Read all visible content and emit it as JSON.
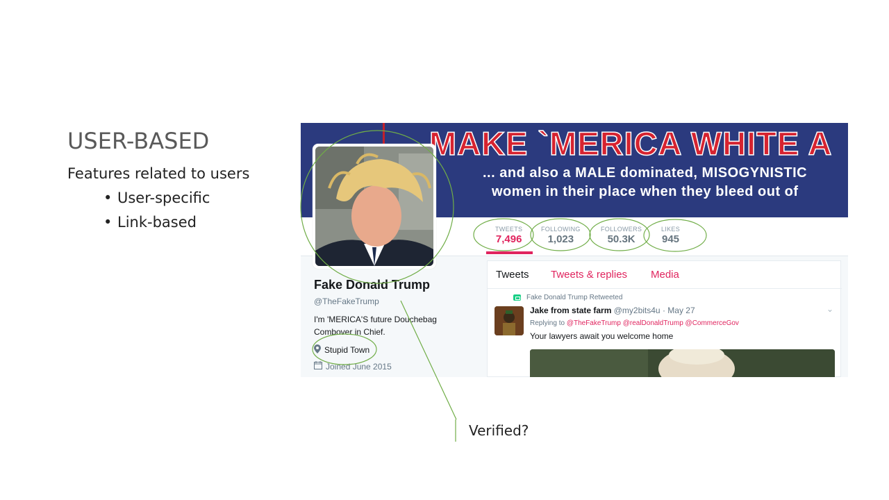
{
  "slide": {
    "title": "USER-BASED",
    "lead": "Features related to users",
    "bullets": [
      "User-specific",
      "Link-based"
    ],
    "callout": "Verified?"
  },
  "banner": {
    "headline": "MAKE `MERICA WHITE A",
    "line1": "... and also a MALE dominated, MISOGYNISTIC",
    "line2": "women in their place when they bleed out of"
  },
  "stats": [
    {
      "label": "TWEETS",
      "value": "7,496"
    },
    {
      "label": "FOLLOWING",
      "value": "1,023"
    },
    {
      "label": "FOLLOWERS",
      "value": "50.3K"
    },
    {
      "label": "LIKES",
      "value": "945"
    }
  ],
  "profile": {
    "name": "Fake Donald Trump",
    "handle": "@TheFakeTrump",
    "bio": "I'm 'MERICA'S future Douchebag Combover in Chief.",
    "location": "Stupid Town",
    "joined": "Joined June 2015"
  },
  "timeline": {
    "tabs": [
      "Tweets",
      "Tweets & replies",
      "Media"
    ],
    "tweet": {
      "retweet_note": "Fake Donald Trump Retweeted",
      "author": "Jake from state farm",
      "author_handle": "@my2bits4u",
      "date": "May 27",
      "replying_label": "Replying to",
      "replying_to": "@TheFakeTrump @realDonaldTrump @CommerceGov",
      "text": "Your lawyers await you welcome home"
    }
  },
  "colors": {
    "banner_bg": "#2b3a7e",
    "accent": "#e0245e",
    "annotation_green": "#70ad47"
  },
  "icons": {
    "location": "map-pin-icon",
    "joined": "calendar-icon",
    "retweet": "retweet-icon",
    "caret": "chevron-down-icon"
  }
}
